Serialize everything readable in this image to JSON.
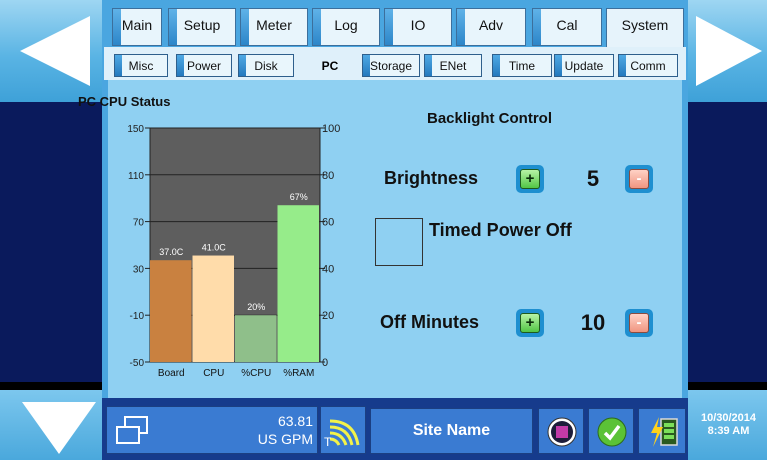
{
  "tabs_main": [
    {
      "label": "Main"
    },
    {
      "label": "Setup"
    },
    {
      "label": "Meter"
    },
    {
      "label": "Log"
    },
    {
      "label": "IO"
    },
    {
      "label": "Adv"
    },
    {
      "label": "Cal"
    },
    {
      "label": "System",
      "active": true
    }
  ],
  "tabs_sub": [
    {
      "label": "Misc"
    },
    {
      "label": "Power"
    },
    {
      "label": "Disk"
    },
    {
      "label": "PC",
      "active": true
    },
    {
      "label": "Storage"
    },
    {
      "label": "ENet"
    },
    {
      "label": "Time"
    },
    {
      "label": "Update"
    },
    {
      "label": "Comm"
    }
  ],
  "chart_data": {
    "type": "bar",
    "title": "PC CPU Status",
    "categories": [
      "Board",
      "CPU",
      "%CPU",
      "%RAM"
    ],
    "values": [
      37.0,
      41.0,
      20,
      67
    ],
    "data_labels": [
      "37.0C",
      "41.0C",
      "20%",
      "67%"
    ],
    "left_axis": {
      "ylim": [
        -50,
        150
      ],
      "ticks": [
        "150",
        "110",
        "70",
        "30",
        "-10",
        "-50"
      ]
    },
    "right_axis": {
      "ylim": [
        0,
        100
      ],
      "ticks": [
        "100",
        "80",
        "60",
        "40",
        "20",
        "0"
      ]
    },
    "colors": [
      "#c98140",
      "#ffdcaa",
      "#8fbf8a",
      "#96ec8a"
    ],
    "plot_background": "#5e5e5e",
    "grid": true
  },
  "backlight": {
    "title": "Backlight Control",
    "brightness_label": "Brightness",
    "brightness_value": "5",
    "timed_power_off_label": "Timed Power Off",
    "off_minutes_label": "Off Minutes",
    "off_minutes_value": "10",
    "plus_glyph": "+",
    "minus_glyph": "-"
  },
  "footer": {
    "flow_value": "63.81",
    "flow_unit": "US GPM",
    "signal_label": "T",
    "site_name": "Site Name",
    "date": "10/30/2014",
    "time": "8:39 AM"
  },
  "colors": {
    "panel_blue": "#4aa6e0",
    "content_bg": "#8fd0f2",
    "footer_bg": "#163b8c"
  }
}
